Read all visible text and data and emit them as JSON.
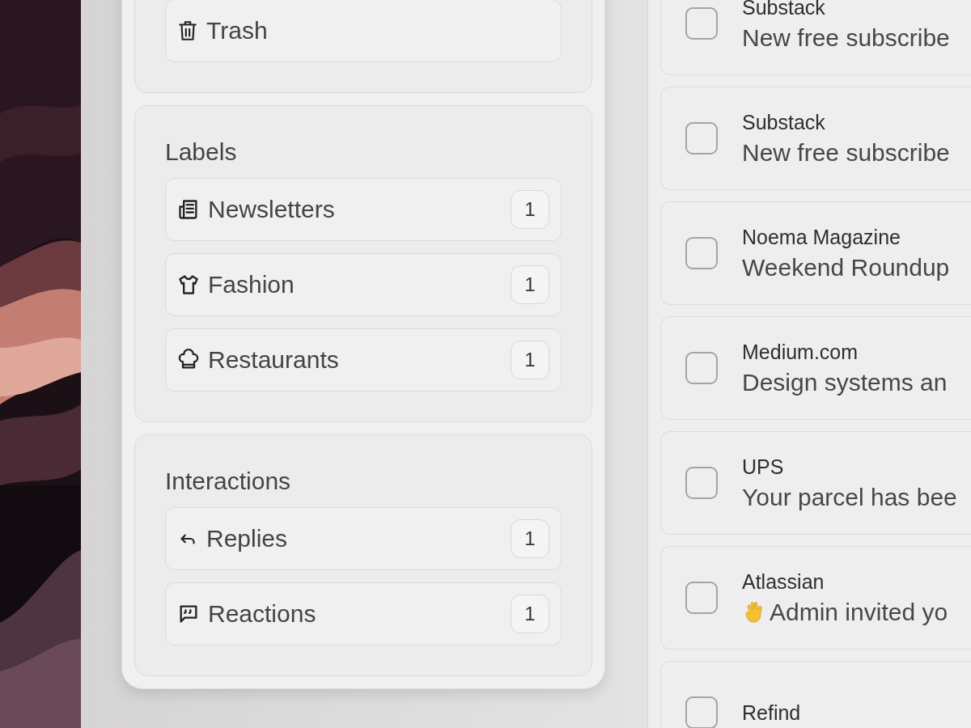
{
  "sidebar": {
    "sections": [
      {
        "items": [
          {
            "label": "Trash"
          }
        ]
      },
      {
        "title": "Labels",
        "items": [
          {
            "label": "Newsletters",
            "count": "1"
          },
          {
            "label": "Fashion",
            "count": "1"
          },
          {
            "label": "Restaurants",
            "count": "1"
          }
        ]
      },
      {
        "title": "Interactions",
        "items": [
          {
            "label": "Replies",
            "count": "1"
          },
          {
            "label": "Reactions",
            "count": "1"
          }
        ]
      }
    ]
  },
  "messages": [
    {
      "kind": "plain",
      "sender": "Substack",
      "subject": "New free subscribe",
      "checked": false
    },
    {
      "kind": "plain",
      "sender": "Substack",
      "subject": "New free subscribe",
      "checked": false
    },
    {
      "kind": "plain",
      "sender": "Noema Magazine",
      "subject": "Weekend Roundup",
      "checked": false
    },
    {
      "kind": "plain",
      "sender": "Medium.com",
      "subject": "Design systems an",
      "checked": false
    },
    {
      "kind": "plain",
      "sender": "UPS",
      "subject": "Your parcel has bee",
      "checked": false
    },
    {
      "kind": "greeting",
      "sender": "Atlassian",
      "subject": "Admin invited yo",
      "checked": false
    },
    {
      "kind": "plain",
      "sender": "Refind",
      "checked": false
    }
  ]
}
